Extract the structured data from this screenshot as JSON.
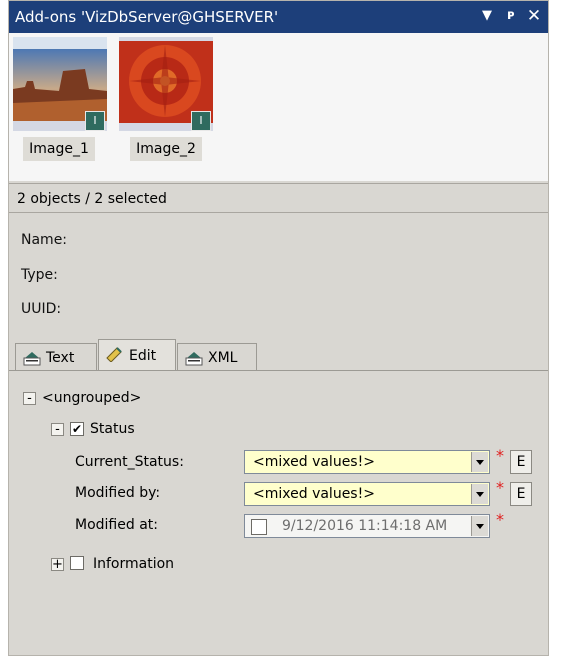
{
  "window": {
    "title": "Add-ons 'VizDbServer@GHSERVER'",
    "dropdown_icon": "dropdown-arrow-icon",
    "pin_icon": "pin-icon",
    "close_icon": "close-icon"
  },
  "thumbnails": [
    {
      "label": "Image_1",
      "badge": "I"
    },
    {
      "label": "Image_2",
      "badge": "I"
    }
  ],
  "status": "2 objects / 2 selected",
  "info": {
    "name_label": "Name:",
    "type_label": "Type:",
    "uuid_label": "UUID:"
  },
  "tabs": [
    {
      "label": "Text",
      "icon": "text-tab-icon"
    },
    {
      "label": "Edit",
      "icon": "edit-tab-icon",
      "active": true
    },
    {
      "label": "XML",
      "icon": "xml-tab-icon"
    }
  ],
  "tree": {
    "group_expander": "-",
    "group_label": "<ungrouped>",
    "status_expander": "-",
    "status_label": "Status",
    "status_checked": "✔",
    "info_expander": "+",
    "info_label": "Information"
  },
  "fields": [
    {
      "label": "Current_Status:",
      "value": "<mixed values!>",
      "required": "*",
      "button": "E"
    },
    {
      "label": "Modified by:",
      "value": "<mixed values!>",
      "required": "*",
      "button": "E"
    },
    {
      "label": "Modified at:",
      "value": "9/12/2016 11:14:18 AM",
      "required": "*"
    }
  ],
  "colors": {
    "titlebar": "#1d3f7a",
    "panel": "#d9d7d2",
    "mixed_value_bg": "#ffffcc",
    "required": "#e01e1e"
  }
}
